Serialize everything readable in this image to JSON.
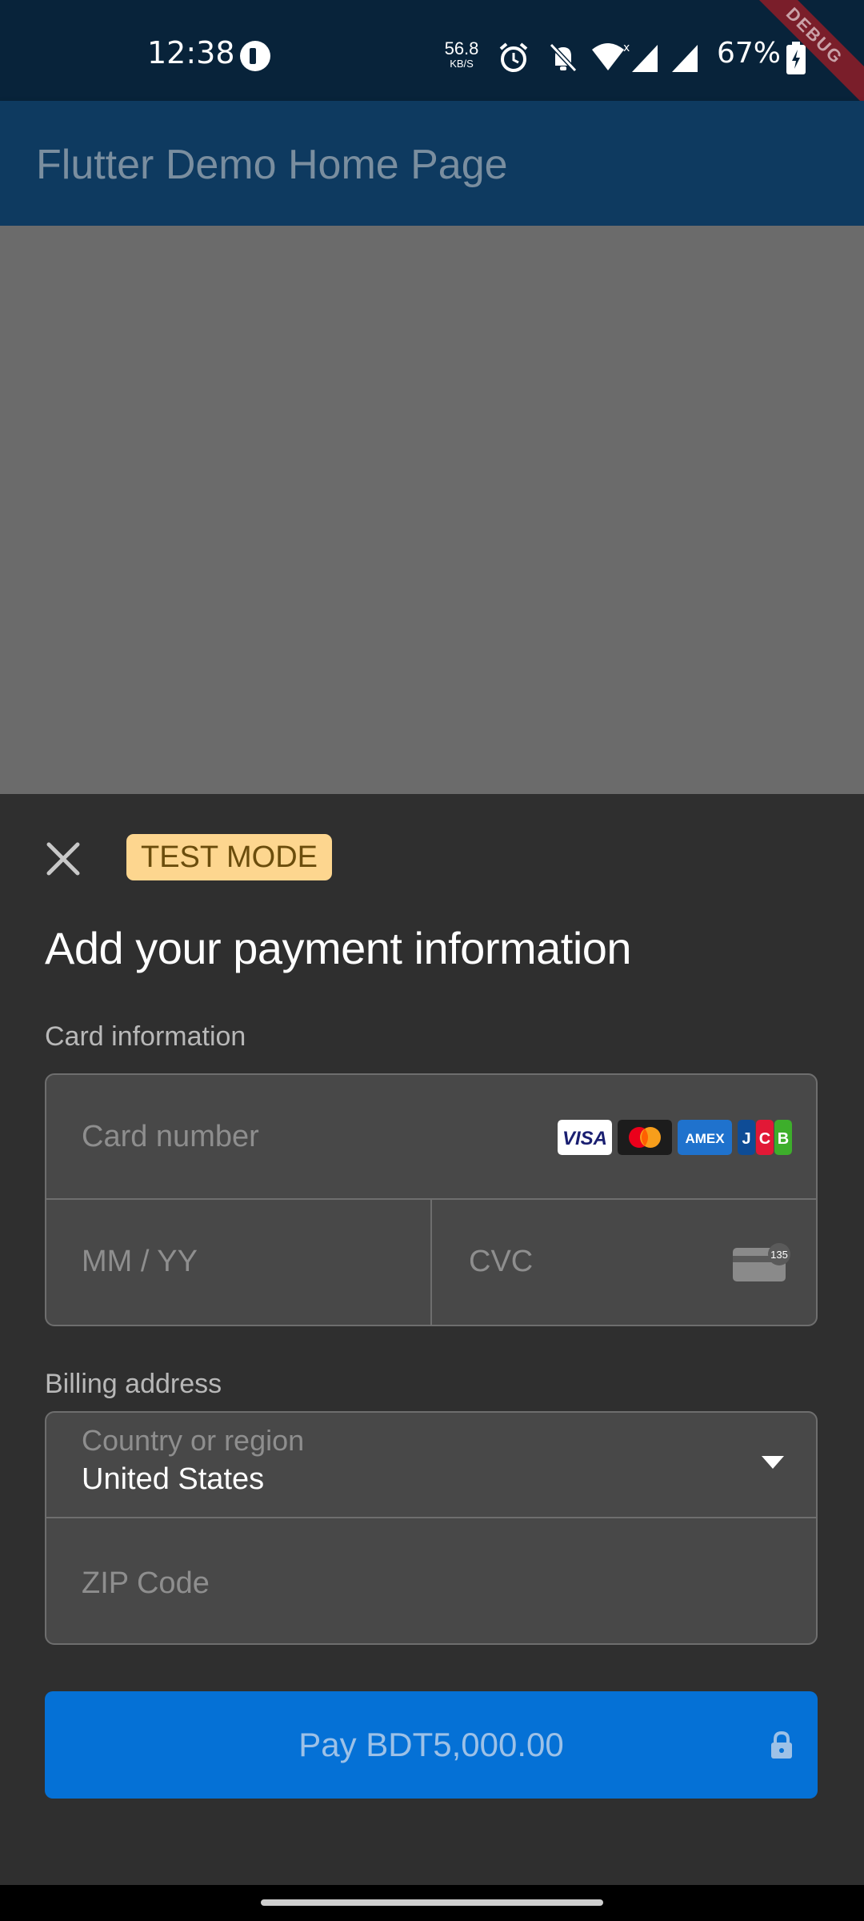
{
  "status_bar": {
    "time": "12:38",
    "speed_value": "56.8",
    "speed_unit": "KB/S",
    "battery_text": "67%",
    "debug_label": "DEBUG",
    "icons": [
      "app-notification-icon",
      "alarm-icon",
      "mute-icon",
      "wifi-icon",
      "signal-icon",
      "signal-icon",
      "battery-charging-icon"
    ]
  },
  "app_bar": {
    "title": "Flutter Demo Home Page"
  },
  "sheet": {
    "test_mode": "TEST MODE",
    "title": "Add your payment information",
    "card_section_label": "Card information",
    "card_number_placeholder": "Card number",
    "expiry_placeholder": "MM / YY",
    "cvc_placeholder": "CVC",
    "cvc_icon_text": "135",
    "brands": [
      "VISA",
      "mastercard",
      "AMEX",
      "JCB"
    ],
    "billing_section_label": "Billing address",
    "country_label": "Country or region",
    "country_value": "United States",
    "zip_placeholder": "ZIP Code",
    "pay_button": "Pay BDT5,000.00"
  },
  "colors": {
    "status_bar": "#08233a",
    "app_bar": "#0e3a60",
    "scrim": "#6b6b6b",
    "sheet": "#2f2f2f",
    "field": "#484848",
    "accent": "#0571d6",
    "test_badge": "#fdd68f"
  }
}
